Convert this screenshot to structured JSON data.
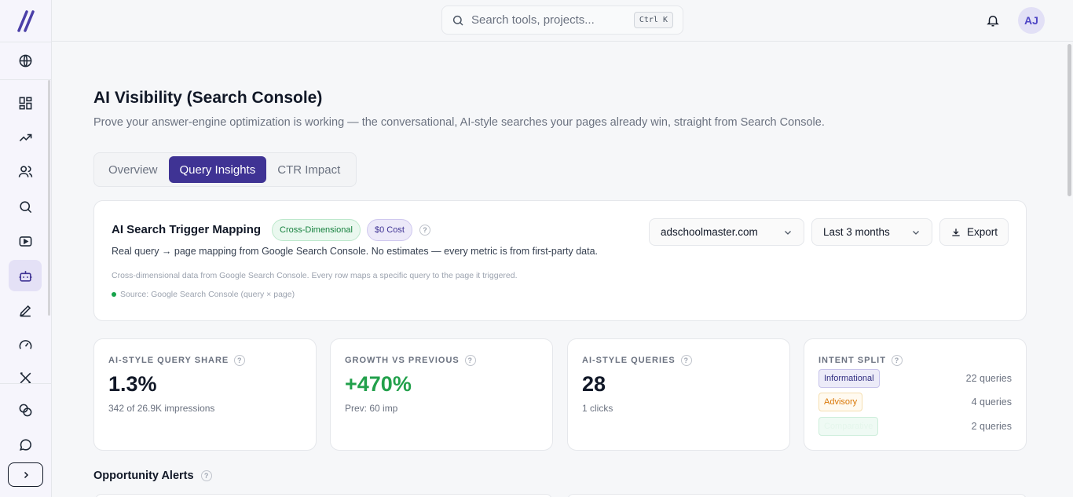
{
  "topbar": {
    "search_placeholder": "Search tools, projects...",
    "search_shortcut": "Ctrl K",
    "avatar_initials": "AJ"
  },
  "sidebar": {
    "icons": [
      "globe-icon",
      "dashboard-icon",
      "trending-up-icon",
      "users-icon",
      "search-icon",
      "video-icon",
      "bot-icon",
      "pen-icon",
      "gauge-icon",
      "tools-icon",
      "coins-icon",
      "chat-icon"
    ],
    "active": "bot-icon"
  },
  "page": {
    "title": "AI Visibility (Search Console)",
    "subtitle": "Prove your answer-engine optimization is working — the conversational, AI-style searches your pages already win, straight from Search Console."
  },
  "tabs": [
    {
      "label": "Overview",
      "active": false
    },
    {
      "label": "Query Insights",
      "active": true
    },
    {
      "label": "CTR Impact",
      "active": false
    }
  ],
  "header_card": {
    "title": "AI Search Trigger Mapping",
    "badge_1": "Cross-Dimensional",
    "badge_2": "$0 Cost",
    "description": "Real query → page mapping from Google Search Console. No estimates — every metric is from first-party data.",
    "note": "Cross-dimensional data from Google Search Console. Every row maps a specific query to the page it triggered.",
    "source": "Source: Google Search Console (query × page)",
    "domain_select": "adschoolmaster.com",
    "range_select": "Last 3 months",
    "export_label": "Export"
  },
  "stats": [
    {
      "label": "AI-STYLE QUERY SHARE",
      "value": "1.3%",
      "sub": "342 of 26.9K impressions"
    },
    {
      "label": "GROWTH VS PREVIOUS",
      "value": "+470%",
      "sub": "Prev: 60 imp"
    },
    {
      "label": "AI-STYLE QUERIES",
      "value": "28",
      "sub": "1 clicks"
    }
  ],
  "intent": {
    "label": "INTENT SPLIT",
    "rows": [
      {
        "chip": "Informational",
        "count": "22 queries"
      },
      {
        "chip": "Advisory",
        "count": "4 queries"
      },
      {
        "chip": "Comparative",
        "count": "2 queries"
      }
    ]
  },
  "alerts": {
    "title": "Opportunity Alerts"
  },
  "colors": {
    "accent": "#3f3394",
    "growth_green": "#22a04b",
    "sidebar_bg": "#f6f5fc"
  }
}
